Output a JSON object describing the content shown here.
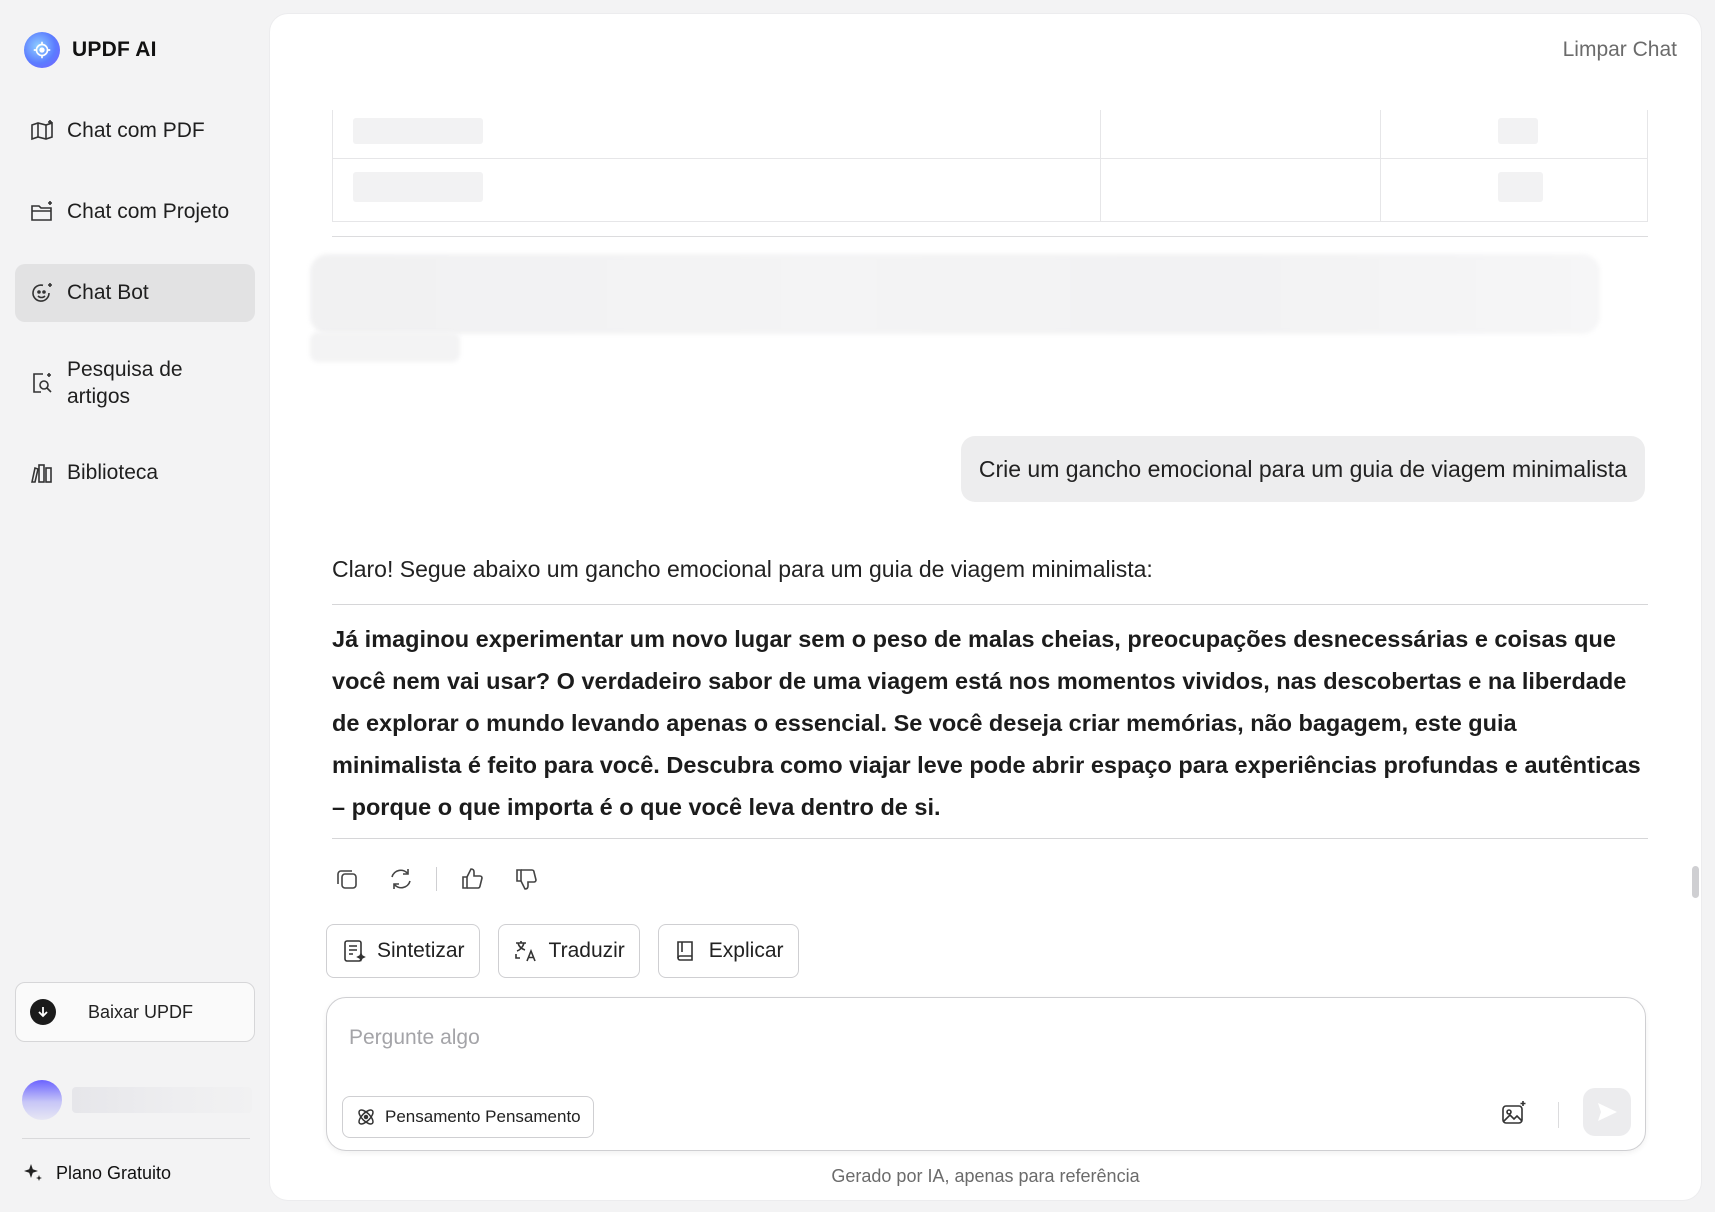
{
  "brand": {
    "name": "UPDF AI",
    "accent": "#5b7cff"
  },
  "nav": {
    "items": [
      {
        "label": "Chat com PDF",
        "icon": "book-sparkle-icon"
      },
      {
        "label": "Chat com Projeto",
        "icon": "folder-sparkle-icon"
      },
      {
        "label": "Chat Bot",
        "icon": "bot-face-icon",
        "active": true
      },
      {
        "label": "Pesquisa de artigos",
        "icon": "doc-search-icon"
      },
      {
        "label": "Biblioteca",
        "icon": "library-icon"
      }
    ]
  },
  "sidebar": {
    "download_label": "Baixar UPDF",
    "plan_label": "Plano Gratuito"
  },
  "header": {
    "clear_chat": "Limpar Chat"
  },
  "chat": {
    "user_message": "Crie um gancho emocional para um guia de viagem minimalista",
    "assistant_intro": "Claro! Segue abaixo um gancho emocional para um guia de viagem minimalista:",
    "assistant_answer": "Já imaginou experimentar um novo lugar sem o peso de malas cheias, preocupações desnecessárias e coisas que você nem vai usar? O verdadeiro sabor de uma viagem está nos momentos vividos, nas descobertas e na liberdade de explorar o mundo levando apenas o essencial. Se você deseja criar memórias, não bagagem, este guia minimalista é feito para você. Descubra como viajar leve pode abrir espaço para experiências profundas e autênticas – porque o que importa é o que você leva dentro de si."
  },
  "quick_actions": [
    {
      "label": "Sintetizar",
      "icon": "summarize-icon"
    },
    {
      "label": "Traduzir",
      "icon": "translate-icon"
    },
    {
      "label": "Explicar",
      "icon": "book-icon"
    }
  ],
  "composer": {
    "placeholder": "Pergunte algo",
    "value": "",
    "thinking_label": "Pensamento Pensamento"
  },
  "footer": {
    "disclaimer": "Gerado por IA, apenas para referência"
  }
}
